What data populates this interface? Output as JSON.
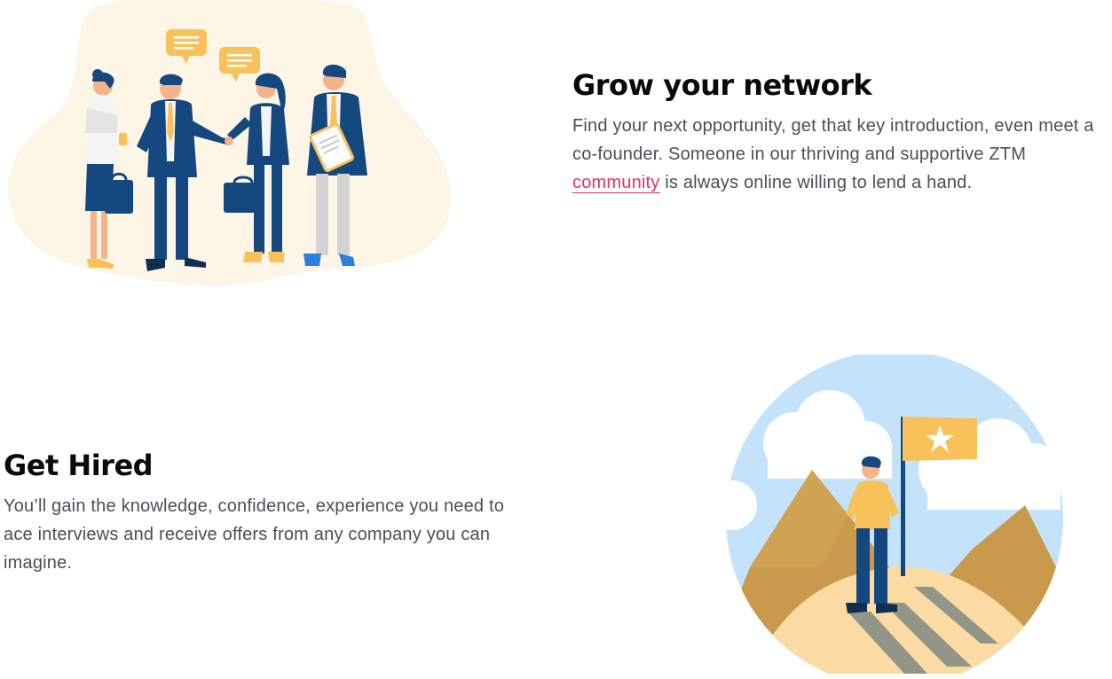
{
  "network": {
    "title": "Grow your network",
    "text_before": "Find your next opportunity, get that key introduction, even meet a co-founder. Someone in our thriving and supportive ZTM ",
    "link_label": "community",
    "text_after": " is always online willing to lend a hand.",
    "illustration": "business-people-handshake-illustration"
  },
  "hired": {
    "title": "Get Hired",
    "text": "You’ll gain the knowledge, confidence, experience you need to ace interviews and receive offers from any company you can imagine.",
    "illustration": "mountain-summit-flag-illustration"
  },
  "colors": {
    "link": "#e4345f",
    "heading": "#0a0a0a",
    "body": "#4a4f55",
    "blob": "#fdf6e6",
    "navy": "#15487e",
    "mustard": "#f5bd54",
    "sky": "#c4e3fb",
    "mountain": "#c99a4b"
  }
}
